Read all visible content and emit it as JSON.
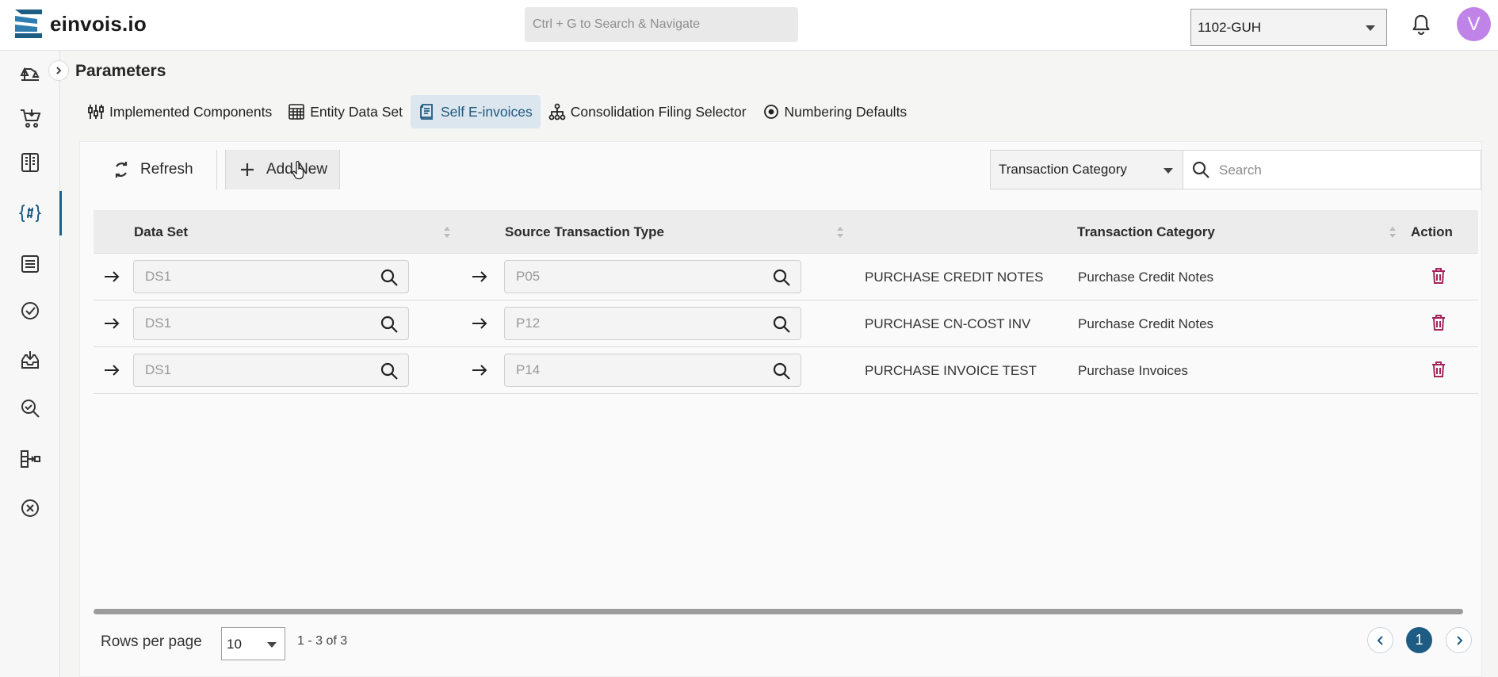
{
  "app": {
    "logo_text": "einvois.io",
    "search_placeholder": "Ctrl + G to Search & Navigate",
    "entity": "1102-GUH",
    "avatar_initial": "V"
  },
  "sidebar": {
    "items": [
      {
        "icon": "scale-icon"
      },
      {
        "icon": "cart-icon"
      },
      {
        "icon": "book-icon"
      },
      {
        "icon": "code-hash-icon",
        "active": true
      },
      {
        "icon": "list-icon"
      },
      {
        "icon": "check-circle-icon"
      },
      {
        "icon": "inbox-download-icon"
      },
      {
        "icon": "search-check-icon"
      },
      {
        "icon": "flow-icon"
      },
      {
        "icon": "cancel-circle-icon"
      }
    ]
  },
  "page": {
    "title": "Parameters",
    "tabs": [
      {
        "label": "Implemented Components",
        "icon": "sliders-icon"
      },
      {
        "label": "Entity Data Set",
        "icon": "calendar-grid-icon"
      },
      {
        "label": "Self E-invoices",
        "icon": "receipt-icon",
        "active": true
      },
      {
        "label": "Consolidation Filing Selector",
        "icon": "hierarchy-icon"
      },
      {
        "label": "Numbering Defaults",
        "icon": "target-icon"
      }
    ]
  },
  "toolbar": {
    "refresh_label": "Refresh",
    "add_label": "Add New",
    "filter_field": "Transaction Category",
    "search_placeholder": "Search"
  },
  "table": {
    "columns": [
      "Data Set",
      "Source Transaction Type",
      "",
      "Transaction Category",
      "Action"
    ],
    "rows": [
      {
        "data_set": "DS1",
        "source_type": "P05",
        "description": "PURCHASE CREDIT NOTES",
        "category": "Purchase Credit Notes"
      },
      {
        "data_set": "DS1",
        "source_type": "P12",
        "description": "PURCHASE CN-COST INV",
        "category": "Purchase Credit Notes"
      },
      {
        "data_set": "DS1",
        "source_type": "P14",
        "description": "PURCHASE INVOICE TEST",
        "category": "Purchase Invoices"
      }
    ]
  },
  "pagination": {
    "rows_per_page_label": "Rows per page",
    "rows_per_page": "10",
    "range": "1 - 3 of 3",
    "current_page": "1"
  },
  "colors": {
    "accent": "#1f5c84",
    "active_tab_bg": "#dbe6ee",
    "delete": "#a3245a",
    "avatar": "#c084e8"
  }
}
